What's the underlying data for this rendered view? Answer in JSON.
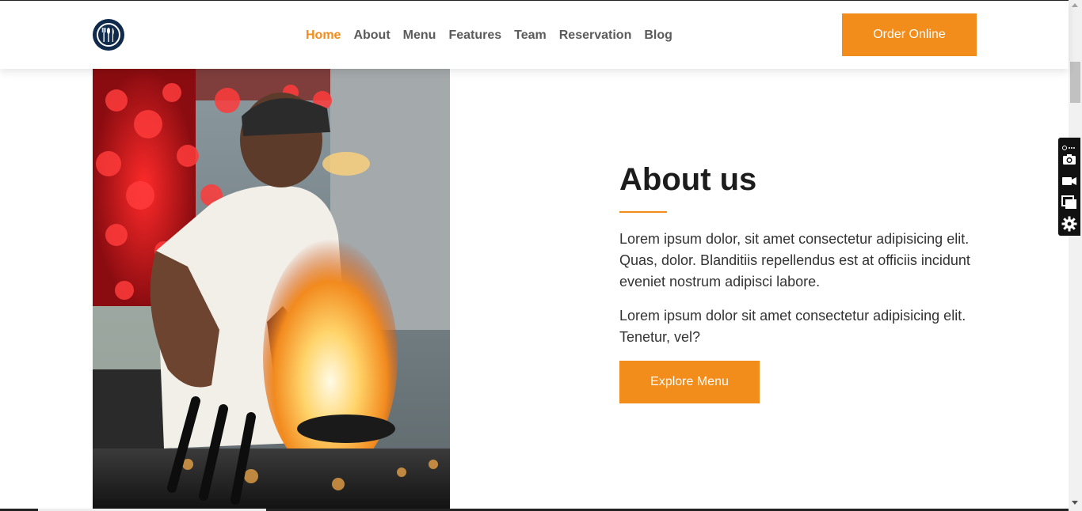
{
  "header": {
    "nav": [
      {
        "label": "Home",
        "active": true
      },
      {
        "label": "About",
        "active": false
      },
      {
        "label": "Menu",
        "active": false
      },
      {
        "label": "Features",
        "active": false
      },
      {
        "label": "Team",
        "active": false
      },
      {
        "label": "Reservation",
        "active": false
      },
      {
        "label": "Blog",
        "active": false
      }
    ],
    "order_label": "Order Online",
    "logo_icon": "utensils-icon"
  },
  "about": {
    "title": "About us",
    "paragraph1": "Lorem ipsum dolor, sit amet consectetur adipisicing elit. Quas, dolor. Blanditiis repellendus est at officiis incidunt eveniet nostrum adipisci labore.",
    "paragraph2": "Lorem ipsum dolor sit amet consectetur adipisicing elit. Tenetur, vel?",
    "button_label": "Explore Menu"
  },
  "photo": {
    "icon": "chef-flambe-photo"
  },
  "side_toolbar": {
    "icons": [
      "link-icon",
      "camera-icon",
      "video-icon",
      "window-icon",
      "gear-icon"
    ]
  },
  "colors": {
    "accent": "#f28c1b",
    "logo_bg": "#0f2a4a",
    "heading": "#1c1c1c",
    "nav_text": "#5b5b5b"
  }
}
